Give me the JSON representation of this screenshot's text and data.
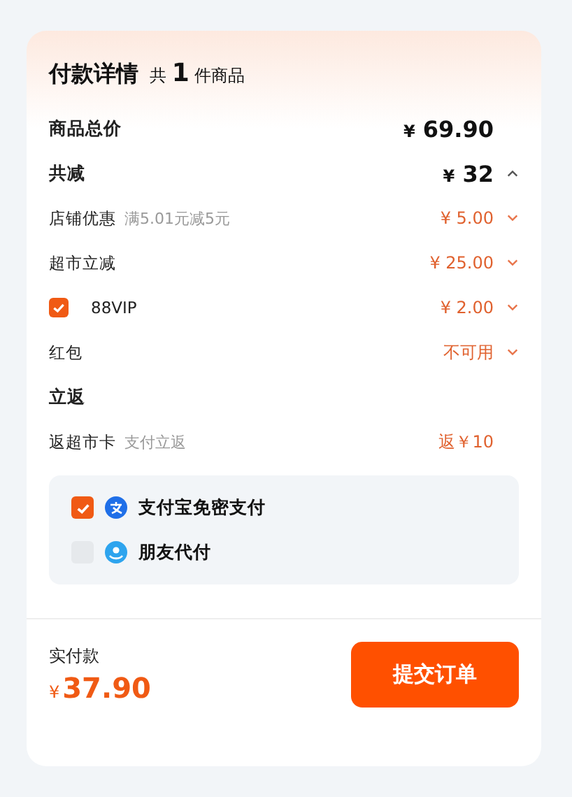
{
  "title": "付款详情",
  "count": {
    "prefix": "共",
    "number": "1",
    "suffix": "件商品"
  },
  "rows": [
    {
      "kind": "main",
      "label": "商品总价",
      "value": "69.90",
      "currency": "¥"
    },
    {
      "kind": "main",
      "label": "共减",
      "value": "32",
      "currency": "¥",
      "expanded": true
    },
    {
      "kind": "sub",
      "label": "店铺优惠",
      "note": "满5.01元减5元",
      "value": "¥ 5.00",
      "expanded": false
    },
    {
      "kind": "sub",
      "label": "超市立减",
      "value": "¥ 25.00",
      "expanded": false
    },
    {
      "kind": "sub",
      "label": "88VIP",
      "checked": true,
      "value": "¥ 2.00",
      "expanded": false
    },
    {
      "kind": "sub",
      "label": "红包",
      "value": "不可用",
      "expanded": false
    },
    {
      "kind": "section",
      "label": "立返"
    },
    {
      "kind": "sub",
      "label": "返超市卡",
      "note": "支付立返",
      "value": "返￥10"
    }
  ],
  "payments": [
    {
      "kind": "alipay",
      "label": "支付宝免密支付",
      "checked": true
    },
    {
      "kind": "friend",
      "label": "朋友代付",
      "checked": false
    }
  ],
  "footer": {
    "label": "实付款",
    "currency": "¥",
    "amount": "37.90",
    "button": "提交订单"
  }
}
